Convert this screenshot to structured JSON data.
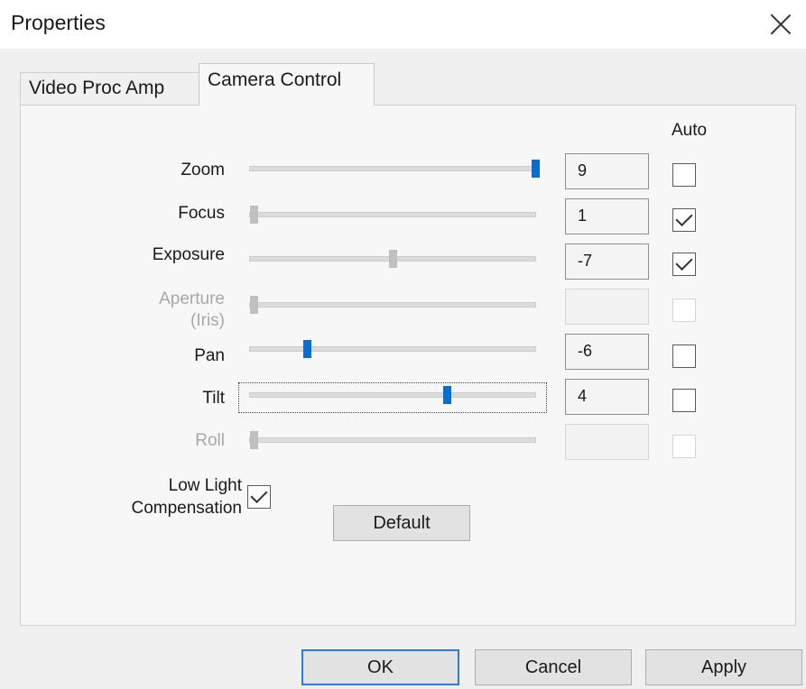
{
  "window": {
    "title": "Properties"
  },
  "tabs": [
    {
      "label": "Video Proc Amp",
      "active": false
    },
    {
      "label": "Camera Control",
      "active": true
    }
  ],
  "auto_header": "Auto",
  "controls": [
    {
      "label": "Zoom",
      "value": "9",
      "auto_checked": false,
      "enabled": true,
      "slider_position": 1.0
    },
    {
      "label": "Focus",
      "value": "1",
      "auto_checked": true,
      "enabled": true,
      "slider_position": 0.0
    },
    {
      "label": "Exposure",
      "value": "-7",
      "auto_checked": true,
      "enabled": true,
      "slider_position": 0.5
    },
    {
      "label_line1": "Aperture",
      "label_line2": "(Iris)",
      "value": "",
      "auto_checked": false,
      "enabled": false,
      "slider_position": 0.0
    },
    {
      "label": "Pan",
      "value": "-6",
      "auto_checked": false,
      "enabled": true,
      "slider_position": 0.2
    },
    {
      "label": "Tilt",
      "value": "4",
      "auto_checked": false,
      "enabled": true,
      "slider_position": 0.69,
      "focused": true
    },
    {
      "label": "Roll",
      "value": "",
      "auto_checked": false,
      "enabled": false,
      "slider_position": 0.0
    }
  ],
  "low_light": {
    "label_line1": "Low Light",
    "label_line2": "Compensation",
    "checked": true
  },
  "buttons": {
    "default": "Default",
    "ok": "OK",
    "cancel": "Cancel",
    "apply": "Apply"
  },
  "colors": {
    "accent": "#0a6ed1",
    "disabled_text": "#a8a8a8",
    "dialog_bg": "#f0f0f0"
  }
}
